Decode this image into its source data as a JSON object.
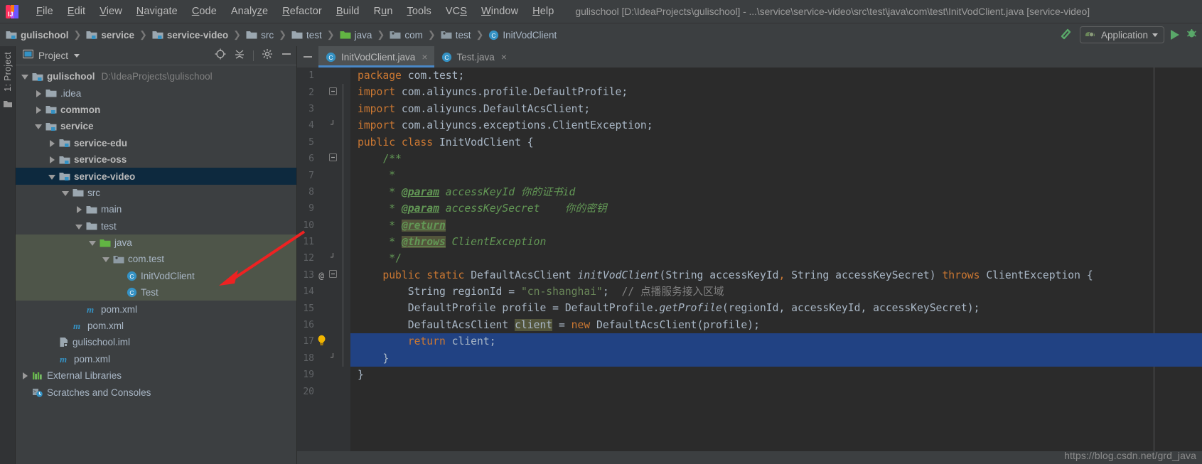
{
  "window": {
    "title": "gulischool [D:\\IdeaProjects\\gulischool] - ...\\service\\service-video\\src\\test\\java\\com\\test\\InitVodClient.java [service-video]",
    "logo_icon": "intellij-idea-logo"
  },
  "menubar": {
    "items": [
      {
        "label": "File",
        "mnemonic": "F"
      },
      {
        "label": "Edit",
        "mnemonic": "E"
      },
      {
        "label": "View",
        "mnemonic": "V"
      },
      {
        "label": "Navigate",
        "mnemonic": "N"
      },
      {
        "label": "Code",
        "mnemonic": "C"
      },
      {
        "label": "Analyze",
        "mnemonic": "z"
      },
      {
        "label": "Refactor",
        "mnemonic": "R"
      },
      {
        "label": "Build",
        "mnemonic": "B"
      },
      {
        "label": "Run",
        "mnemonic": "u"
      },
      {
        "label": "Tools",
        "mnemonic": "T"
      },
      {
        "label": "VCS",
        "mnemonic": "S"
      },
      {
        "label": "Window",
        "mnemonic": "W"
      },
      {
        "label": "Help",
        "mnemonic": "H"
      }
    ]
  },
  "breadcrumb": {
    "items": [
      {
        "label": "gulischool",
        "icon": "module-folder-icon",
        "bold": true
      },
      {
        "label": "service",
        "icon": "module-folder-icon",
        "bold": true
      },
      {
        "label": "service-video",
        "icon": "module-folder-icon",
        "bold": true
      },
      {
        "label": "src",
        "icon": "folder-icon",
        "bold": false
      },
      {
        "label": "test",
        "icon": "folder-icon",
        "bold": false
      },
      {
        "label": "java",
        "icon": "source-root-folder-icon",
        "bold": false
      },
      {
        "label": "com",
        "icon": "package-icon",
        "bold": false
      },
      {
        "label": "test",
        "icon": "package-icon",
        "bold": false
      },
      {
        "label": "InitVodClient",
        "icon": "java-class-icon",
        "bold": false
      }
    ],
    "separator": "❯"
  },
  "toolbar": {
    "build_icon": "hammer-icon",
    "run_config_label": "Application",
    "run_config_icon": "application-run-config-icon",
    "run_icon": "run-play-icon",
    "debug_icon": "debug-bug-icon"
  },
  "toolstrip": {
    "label": "1: Project",
    "icon": "project-folder-icon",
    "bottom_icon": "structure-icon"
  },
  "project_panel": {
    "title": "Project",
    "title_icon": "project-view-icon",
    "dropdown_icon": "chevron-down-icon",
    "locate_icon": "crosshair-target-icon",
    "collapse_all_icon": "collapse-all-icon",
    "settings_icon": "gear-icon",
    "hide_icon": "minimize-icon",
    "tree": [
      {
        "label": "gulischool",
        "path": "D:\\IdeaProjects\\gulischool",
        "indent": 0,
        "twisty": "down",
        "icon": "module-folder-icon",
        "bold": true,
        "selected": "none"
      },
      {
        "label": ".idea",
        "path": "",
        "indent": 1,
        "twisty": "right",
        "icon": "folder-icon",
        "bold": false,
        "selected": "none"
      },
      {
        "label": "common",
        "path": "",
        "indent": 1,
        "twisty": "right",
        "icon": "module-folder-icon",
        "bold": true,
        "selected": "none"
      },
      {
        "label": "service",
        "path": "",
        "indent": 1,
        "twisty": "down",
        "icon": "module-folder-icon",
        "bold": true,
        "selected": "none"
      },
      {
        "label": "service-edu",
        "path": "",
        "indent": 2,
        "twisty": "right",
        "icon": "module-folder-icon",
        "bold": true,
        "selected": "none"
      },
      {
        "label": "service-oss",
        "path": "",
        "indent": 2,
        "twisty": "right",
        "icon": "module-folder-icon",
        "bold": true,
        "selected": "none"
      },
      {
        "label": "service-video",
        "path": "",
        "indent": 2,
        "twisty": "down",
        "icon": "module-folder-icon",
        "bold": true,
        "selected": "blue"
      },
      {
        "label": "src",
        "path": "",
        "indent": 3,
        "twisty": "down",
        "icon": "folder-icon",
        "bold": false,
        "selected": "none"
      },
      {
        "label": "main",
        "path": "",
        "indent": 4,
        "twisty": "right",
        "icon": "folder-icon",
        "bold": false,
        "selected": "none"
      },
      {
        "label": "test",
        "path": "",
        "indent": 4,
        "twisty": "down",
        "icon": "folder-icon",
        "bold": false,
        "selected": "none"
      },
      {
        "label": "java",
        "path": "",
        "indent": 5,
        "twisty": "down",
        "icon": "test-source-root-icon",
        "bold": false,
        "selected": "green"
      },
      {
        "label": "com.test",
        "path": "",
        "indent": 6,
        "twisty": "down",
        "icon": "package-icon",
        "bold": false,
        "selected": "green"
      },
      {
        "label": "InitVodClient",
        "path": "",
        "indent": 7,
        "twisty": "none",
        "icon": "java-class-icon",
        "bold": false,
        "selected": "green"
      },
      {
        "label": "Test",
        "path": "",
        "indent": 7,
        "twisty": "none",
        "icon": "java-class-icon",
        "bold": false,
        "selected": "green"
      },
      {
        "label": "pom.xml",
        "path": "",
        "indent": 4,
        "twisty": "none",
        "icon": "maven-icon",
        "bold": false,
        "selected": "none"
      },
      {
        "label": "pom.xml",
        "path": "",
        "indent": 3,
        "twisty": "none",
        "icon": "maven-icon",
        "bold": false,
        "selected": "none"
      },
      {
        "label": "gulischool.iml",
        "path": "",
        "indent": 2,
        "twisty": "none",
        "icon": "iml-file-icon",
        "bold": false,
        "selected": "none"
      },
      {
        "label": "pom.xml",
        "path": "",
        "indent": 2,
        "twisty": "none",
        "icon": "maven-icon",
        "bold": false,
        "selected": "none"
      },
      {
        "label": "External Libraries",
        "path": "",
        "indent": 0,
        "twisty": "right",
        "icon": "libraries-icon",
        "bold": false,
        "selected": "none"
      },
      {
        "label": "Scratches and Consoles",
        "path": "",
        "indent": 0,
        "twisty": "none",
        "icon": "scratches-icon",
        "bold": false,
        "selected": "none"
      }
    ]
  },
  "editor": {
    "tabs": [
      {
        "label": "InitVodClient.java",
        "icon": "java-class-icon",
        "active": true,
        "close_icon": "close-icon"
      },
      {
        "label": "Test.java",
        "icon": "java-class-icon",
        "active": false,
        "close_icon": "close-icon"
      }
    ],
    "line_numbers": [
      "1",
      "2",
      "3",
      "4",
      "5",
      "6",
      "7",
      "8",
      "9",
      "10",
      "11",
      "12",
      "13",
      "14",
      "15",
      "16",
      "17",
      "18",
      "19",
      "20"
    ],
    "gutter_marks": {
      "13": "@",
      "17": "intention-bulb-icon"
    },
    "highlighted_lines": [
      17,
      18
    ],
    "code_lines": [
      "package com.test;",
      "import com.aliyuncs.profile.DefaultProfile;",
      "import com.aliyuncs.DefaultAcsClient;",
      "import com.aliyuncs.exceptions.ClientException;",
      "public class InitVodClient {",
      "    /**",
      "     *",
      "     * @param accessKeyId 你的证书id",
      "     * @param accessKeySecret    你的密钥",
      "     * @return",
      "     * @throws ClientException",
      "     */",
      "    public static DefaultAcsClient initVodClient(String accessKeyId, String accessKeySecret) throws ClientException {",
      "        String regionId = \"cn-shanghai\";  // 点播服务接入区域",
      "        DefaultProfile profile = DefaultProfile.getProfile(regionId, accessKeyId, accessKeySecret);",
      "        DefaultAcsClient client = new DefaultAcsClient(profile);",
      "        return client;",
      "    }",
      "}",
      ""
    ]
  },
  "annotation": {
    "red_arrow": "red-arrow-pointer",
    "watermark": "https://blog.csdn.net/grd_java"
  },
  "colors": {
    "bg_chrome": "#3c3f41",
    "bg_editor": "#2b2b2b",
    "bg_gutter": "#313335",
    "accent_tab": "#4a88c7",
    "selection_blue": "#214283",
    "tree_select_blue": "#0d293e",
    "tree_select_green": "#4e5549",
    "keyword": "#cc7832",
    "string": "#6a8759",
    "comment": "#808080",
    "javadoc": "#629755",
    "text": "#a9b7c6",
    "run_green": "#59a869",
    "arrow_red": "#ee2222"
  }
}
